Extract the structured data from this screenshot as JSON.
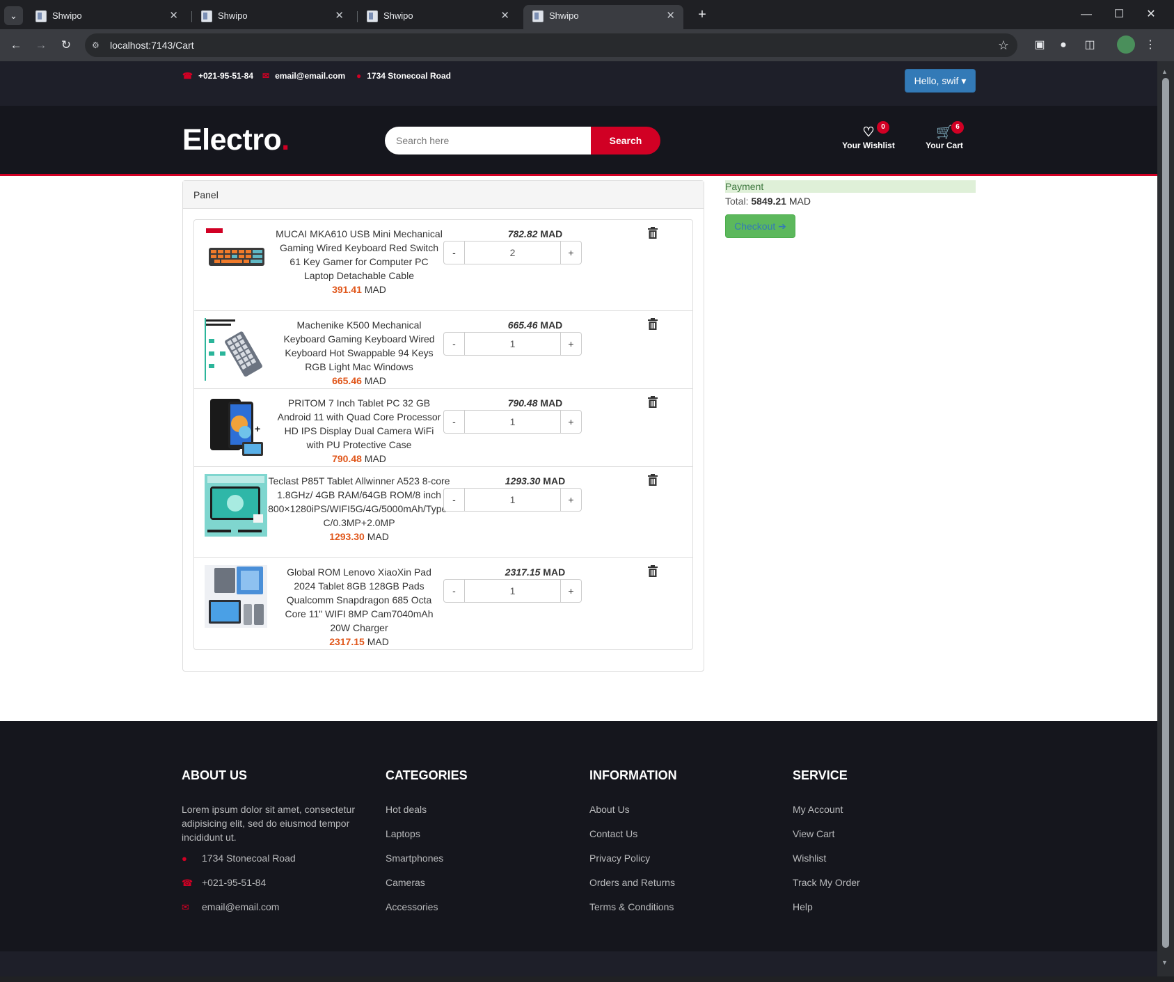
{
  "browser": {
    "tabs": [
      {
        "title": "Shwipo"
      },
      {
        "title": "Shwipo"
      },
      {
        "title": "Shwipo"
      },
      {
        "title": "Shwipo"
      }
    ],
    "address": "localhost:7143/Cart",
    "icons": {
      "tab_menu": "chevron-down-icon",
      "back": "arrow-left-icon",
      "forward": "arrow-right-icon",
      "reload": "reload-icon",
      "site_info": "tune-icon",
      "bookmark": "star-icon",
      "extensions": "puzzle-icon",
      "menu": "kebab-icon"
    }
  },
  "header": {
    "phone": "+021-95-51-84",
    "email": "email@email.com",
    "address": "1734 Stonecoal Road",
    "account_label": "Hello, swif ▾",
    "logo_text": "Electro",
    "logo_dot": ".",
    "search_placeholder": "Search here",
    "search_button": "Search",
    "wishlist_label": "Your Wishlist",
    "wishlist_count": "0",
    "cart_label": "Your Cart",
    "cart_count": "6"
  },
  "cart": {
    "panel_title": "Panel",
    "currency": "MAD",
    "items": [
      {
        "name": "MUCAI MKA610 USB Mini Mechanical Gaming Wired Keyboard Red Switch 61 Key Gamer for Computer PC Laptop Detachable Cable",
        "unit_price": "391.41",
        "line_total": "782.82",
        "quantity": "2"
      },
      {
        "name": "Machenike K500 Mechanical Keyboard Gaming Keyboard Wired Keyboard Hot Swappable 94 Keys RGB Light Mac Windows",
        "unit_price": "665.46",
        "line_total": "665.46",
        "quantity": "1"
      },
      {
        "name": "PRITOM 7 Inch Tablet PC 32 GB Android 11 with Quad Core Processor HD IPS Display Dual Camera WiFi with PU Protective Case",
        "unit_price": "790.48",
        "line_total": "790.48",
        "quantity": "1"
      },
      {
        "name": "Teclast P85T Tablet Allwinner A523 8-core 1.8GHz/ 4GB RAM/64GB ROM/8 inch 800×1280iPS/WIFI5G/4G/5000mAh/Type-C/0.3MP+2.0MP",
        "unit_price": "1293.30",
        "line_total": "1293.30",
        "quantity": "1"
      },
      {
        "name": "Global ROM Lenovo XiaoXin Pad 2024 Tablet 8GB 128GB Pads Qualcomm Snapdragon 685 Octa Core 11\" WIFI 8MP Cam7040mAh 20W Charger",
        "unit_price": "2317.15",
        "line_total": "2317.15",
        "quantity": "1"
      }
    ],
    "minus_label": "-",
    "plus_label": "+"
  },
  "payment": {
    "heading": "Payment",
    "total_label": "Total:",
    "total_value": "5849.21",
    "currency": "MAD",
    "checkout_label": "Checkout ➔"
  },
  "footer": {
    "about_title": "ABOUT US",
    "about_text": "Lorem ipsum dolor sit amet, consectetur adipisicing elit, sed do eiusmod tempor incididunt ut.",
    "address": "1734 Stonecoal Road",
    "phone": "+021-95-51-84",
    "email": "email@email.com",
    "categories_title": "CATEGORIES",
    "categories": [
      "Hot deals",
      "Laptops",
      "Smartphones",
      "Cameras",
      "Accessories"
    ],
    "information_title": "INFORMATION",
    "information": [
      "About Us",
      "Contact Us",
      "Privacy Policy",
      "Orders and Returns",
      "Terms & Conditions"
    ],
    "service_title": "SERVICE",
    "service": [
      "My Account",
      "View Cart",
      "Wishlist",
      "Track My Order",
      "Help"
    ]
  },
  "colors": {
    "accent": "#d10024",
    "header_dark": "#15161d",
    "top_header": "#1e1f29",
    "price_orange": "#e0561a",
    "account_blue": "#337ab7",
    "checkout_green": "#5cb85c"
  }
}
